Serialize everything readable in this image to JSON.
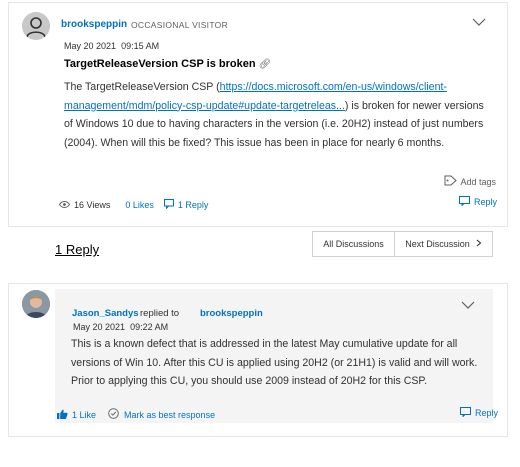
{
  "post": {
    "author": "brookspeppin",
    "rank": "OCCASIONAL VISITOR",
    "date": "May 20 2021",
    "time": "09:15 AM",
    "subject": "TargetReleaseVersion CSP is broken",
    "body_prefix": "The TargetReleaseVersion CSP (",
    "body_link": "https://docs.microsoft.com/en-us/windows/client-management/mdm/policy-csp-update#update-targetreleas...",
    "body_suffix": ") is broken for newer versions of Windows 10 due to having characters in the version (i.e. 20H2) instead of just numbers (2004). When will this be fixed? This issue has been in place for nearly 6 months.",
    "add_tags": "Add tags",
    "views": "16 Views",
    "likes": "0 Likes",
    "replies": "1 Reply",
    "reply_label": "Reply"
  },
  "thread": {
    "heading": "1 Reply",
    "all_discussions": "All Discussions",
    "next_discussion": "Next Discussion"
  },
  "reply": {
    "author": "Jason_Sandys",
    "replied_to_label": "replied to",
    "replied_to": "brookspeppin",
    "date": "May 20 2021",
    "time": "09:22 AM",
    "body": "This is a known defect that is addressed in the latest May cumulative update for all versions of Win 10. After this CU is applied using 20H2 (or 21H1) is valid and will work. Prior to applying this CU, you should use 2009 instead of 20H2 for this CSP.",
    "likes": "1 Like",
    "best_response": "Mark as best response",
    "reply_label": "Reply"
  },
  "colors": {
    "link": "#0072c6",
    "reply_background": "#f4f4f4",
    "text": "#323130"
  },
  "icons": [
    "user-avatar-icon",
    "chevron-down-icon",
    "link-icon",
    "tag-icon",
    "eye-icon",
    "comment-icon",
    "reply-icon",
    "chevron-right-icon",
    "thumbs-up-icon",
    "checkmark-circle-icon"
  ]
}
